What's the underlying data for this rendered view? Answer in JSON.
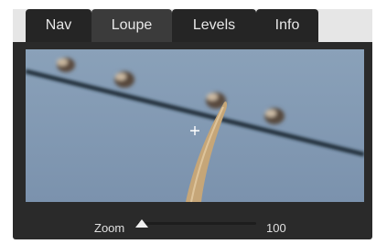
{
  "tabs": [
    {
      "label": "Nav"
    },
    {
      "label": "Loupe"
    },
    {
      "label": "Levels"
    },
    {
      "label": "Info"
    }
  ],
  "active_tab": "Loupe",
  "zoom": {
    "label": "Zoom",
    "value": "100",
    "slider_fraction": 0.0
  },
  "colors": {
    "panel_bg": "#2a2a2a",
    "active_tab": "#3b3b3b",
    "sky": "#7f97b1"
  }
}
